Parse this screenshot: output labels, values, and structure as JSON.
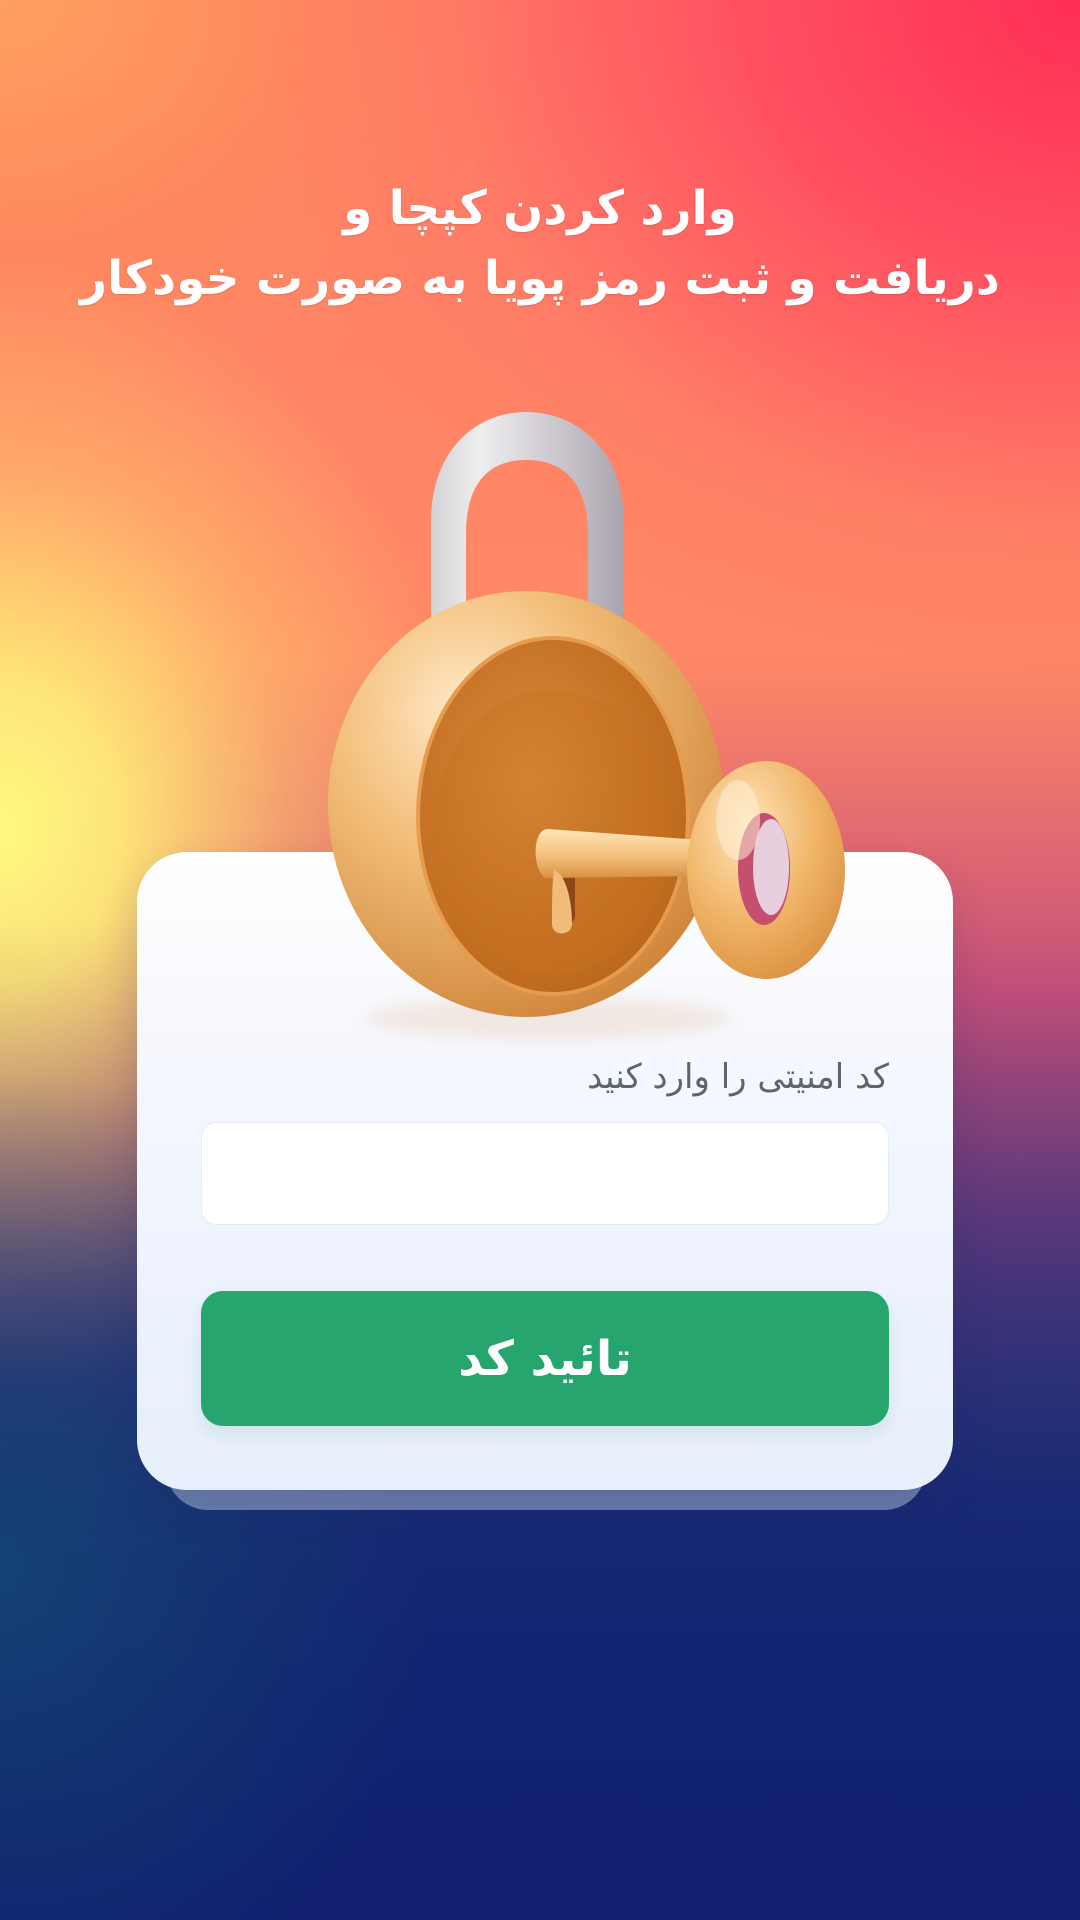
{
  "header": {
    "title_line_1": "وارد کردن کپچا و",
    "title_line_2": "دریافت و ثبت رمز پویا به صورت خودکار"
  },
  "illustration": {
    "icon": "padlock-with-key-icon"
  },
  "captcha_form": {
    "label": "کد امنیتی را وارد کنید",
    "input_value": "",
    "input_placeholder": "",
    "submit_label": "تائید کد"
  },
  "colors": {
    "primary_button": "#26a56f",
    "card_background": "#f1f5fd",
    "title_text": "#ffffff",
    "label_text": "#5c6670"
  }
}
